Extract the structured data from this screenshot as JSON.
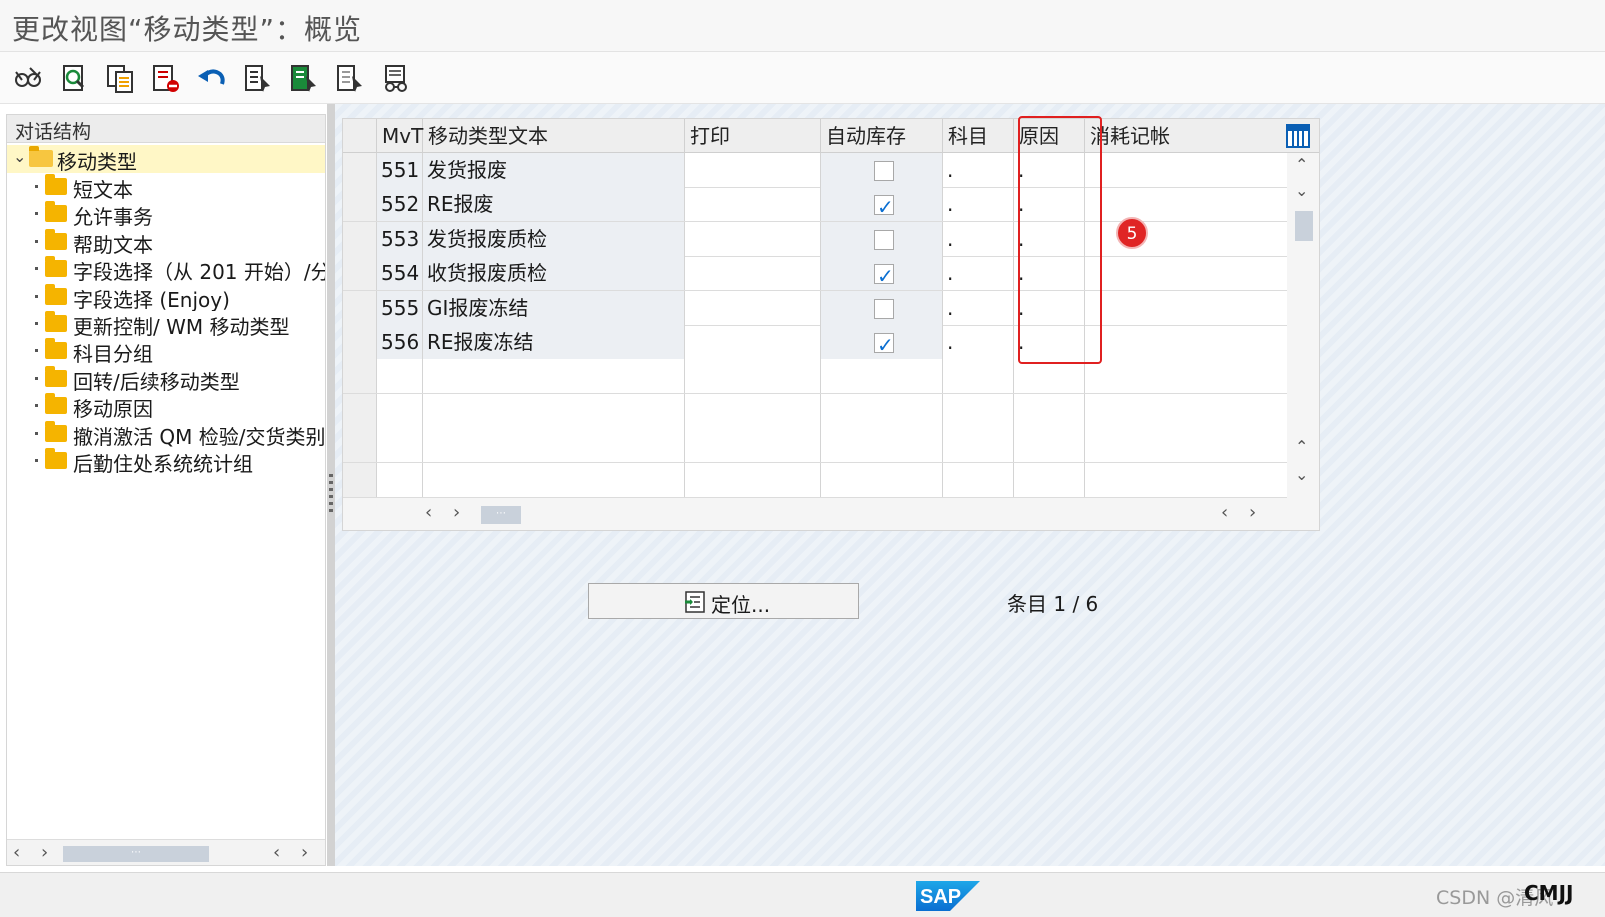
{
  "window": {
    "title": "更改视图“移动类型”：概览"
  },
  "toolbar": {
    "buttons": [
      {
        "name": "display-change-toggle-icon"
      },
      {
        "name": "details-icon"
      },
      {
        "name": "copy-as-icon"
      },
      {
        "name": "delete-icon"
      },
      {
        "name": "undo-icon"
      },
      {
        "name": "select-all-icon"
      },
      {
        "name": "select-block-icon"
      },
      {
        "name": "deselect-all-icon"
      },
      {
        "name": "glasses-icon"
      }
    ]
  },
  "tree": {
    "header": "对话结构",
    "root": "移动类型",
    "items": [
      {
        "label": "短文本"
      },
      {
        "label": "允许事务"
      },
      {
        "label": "帮助文本"
      },
      {
        "label": "字段选择（从 201 开始）/分"
      },
      {
        "label": "字段选择 (Enjoy)"
      },
      {
        "label": "更新控制/ WM 移动类型"
      },
      {
        "label": "科目分组"
      },
      {
        "label": "回转/后续移动类型"
      },
      {
        "label": "移动原因"
      },
      {
        "label": "撤消激活 QM 检验/交货类别"
      },
      {
        "label": "后勤住处系统统计组"
      }
    ]
  },
  "table": {
    "columns": [
      "MvT",
      "移动类型文本",
      "打印",
      "自动库存",
      "科目",
      "原因",
      "消耗记帐"
    ],
    "rows": [
      {
        "mvt": "551",
        "text": "发货报废",
        "print": "",
        "auto": false,
        "acct": ".",
        "reason": ".",
        "cons": ""
      },
      {
        "mvt": "552",
        "text": "RE报废",
        "print": "",
        "auto": true,
        "acct": ".",
        "reason": ".",
        "cons": ""
      },
      {
        "mvt": "553",
        "text": "发货报废质检",
        "print": "",
        "auto": false,
        "acct": ".",
        "reason": ".",
        "cons": ""
      },
      {
        "mvt": "554",
        "text": "收货报废质检",
        "print": "",
        "auto": true,
        "acct": ".",
        "reason": ".",
        "cons": ""
      },
      {
        "mvt": "555",
        "text": "GI报废冻结",
        "print": "",
        "auto": false,
        "acct": ".",
        "reason": ".",
        "cons": ""
      },
      {
        "mvt": "556",
        "text": "RE报废冻结",
        "print": "",
        "auto": true,
        "acct": ".",
        "reason": ".",
        "cons": ""
      }
    ],
    "empty_rows": 4
  },
  "annotation": {
    "marker": "5",
    "color": "#e02020"
  },
  "position_button": "定位...",
  "entry": {
    "label": "条目",
    "value": "1 / 6"
  },
  "status": {
    "sap_logo": "SAP",
    "watermark": "CSDN @清风",
    "user": "CMJJ"
  }
}
